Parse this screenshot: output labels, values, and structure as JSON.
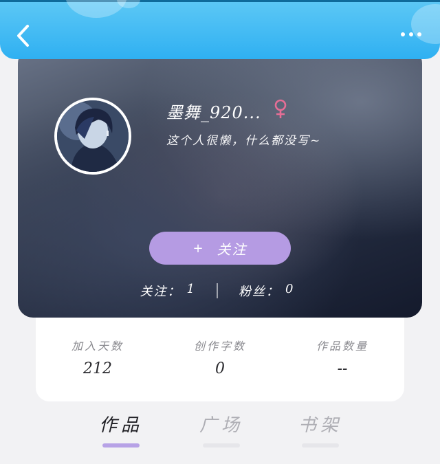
{
  "header": {
    "back_icon": "chevron-left-icon",
    "more_icon": "more-horizontal-icon"
  },
  "profile": {
    "username": "墨舞_920...",
    "gender_icon": "female-icon",
    "gender_color": "#e66e96",
    "bio": "这个人很懒，什么都没写~",
    "follow_plus": "+",
    "follow_label": "关注",
    "follow_button_color": "#b59be3",
    "following_label": "关注：",
    "following_count": "1",
    "fans_label": "粉丝：",
    "fans_count": "0"
  },
  "stats": [
    {
      "label": "加入天数",
      "value": "212"
    },
    {
      "label": "创作字数",
      "value": "0"
    },
    {
      "label": "作品数量",
      "value": "--"
    }
  ],
  "tabs": [
    {
      "label": "作品",
      "active": true
    },
    {
      "label": "广场",
      "active": false
    },
    {
      "label": "书架",
      "active": false
    }
  ],
  "colors": {
    "header": "#2fb0f2",
    "tab_indicator": "#b7a2e6"
  }
}
